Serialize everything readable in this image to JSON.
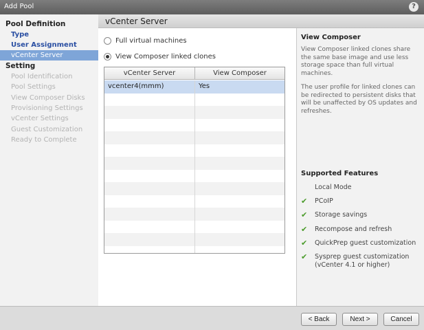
{
  "window": {
    "title": "Add Pool",
    "help": "?"
  },
  "nav": {
    "groups": [
      {
        "label": "Pool Definition"
      },
      {
        "label": "Setting"
      }
    ],
    "items": [
      {
        "label": "Type"
      },
      {
        "label": "User Assignment"
      },
      {
        "label": "vCenter Server"
      },
      {
        "label": "Pool Identification"
      },
      {
        "label": "Pool Settings"
      },
      {
        "label": "View Composer Disks"
      },
      {
        "label": "Provisioning Settings"
      },
      {
        "label": "vCenter Settings"
      },
      {
        "label": "Guest Customization"
      },
      {
        "label": "Ready to Complete"
      }
    ]
  },
  "main": {
    "title": "vCenter Server",
    "options": [
      {
        "label": "Full virtual machines",
        "selected": false
      },
      {
        "label": "View Composer linked clones",
        "selected": true
      }
    ],
    "table": {
      "headers": [
        "vCenter Server",
        "View Composer"
      ],
      "rows": [
        {
          "server": "vcenter4(mmm)",
          "composer": "Yes"
        }
      ]
    }
  },
  "info": {
    "title": "View Composer",
    "paragraphs": [
      "View Composer linked clones share the same base image and use less storage space than full virtual machines.",
      "The user profile for linked clones can be redirected to persistent disks that will be unaffected by OS updates and refreshes."
    ],
    "features_title": "Supported Features",
    "features": [
      {
        "label": "Local Mode",
        "supported": false
      },
      {
        "label": "PCoIP",
        "supported": true
      },
      {
        "label": "Storage savings",
        "supported": true
      },
      {
        "label": "Recompose and refresh",
        "supported": true
      },
      {
        "label": "QuickPrep guest customization",
        "supported": true
      },
      {
        "label": "Sysprep guest customization (vCenter 4.1 or higher)",
        "supported": true
      }
    ]
  },
  "footer": {
    "back": "< Back",
    "next": "Next >",
    "cancel": "Cancel"
  },
  "colors": {
    "accent_selection": "#7ea5d8",
    "link": "#2a4fa2",
    "check_green": "#4a9b2a",
    "row_selected": "#c9daf1"
  }
}
